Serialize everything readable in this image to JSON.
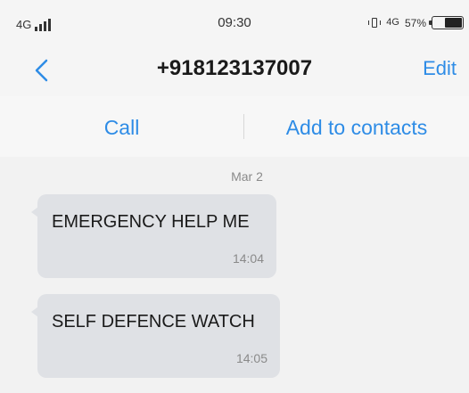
{
  "status_bar": {
    "network": "4G",
    "time": "09:30",
    "network_right": "4G",
    "battery": "57%"
  },
  "header": {
    "back_icon": "chevron-left-icon",
    "title": "+918123137007",
    "edit_label": "Edit"
  },
  "actions": {
    "call_label": "Call",
    "add_contact_label": "Add to contacts"
  },
  "thread": {
    "date": "Mar 2",
    "messages": [
      {
        "text": "EMERGENCY HELP ME",
        "time": "14:04"
      },
      {
        "text": "SELF DEFENCE WATCH",
        "time": "14:05"
      }
    ]
  },
  "colors": {
    "accent": "#2e8ce6",
    "bubble": "#dfe1e5",
    "background": "#f2f2f2"
  }
}
